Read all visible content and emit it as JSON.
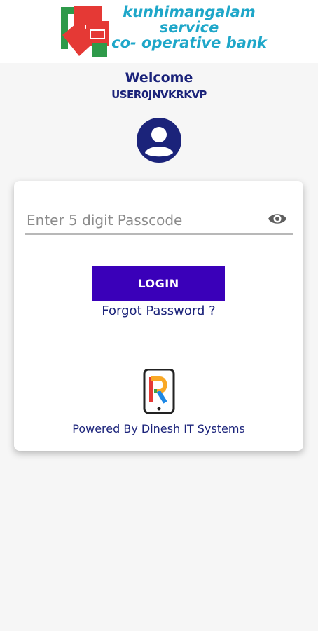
{
  "header": {
    "bank_name_line1": "kunhimangalam",
    "bank_name_line2": "service",
    "bank_name_line3": "co- operative bank",
    "logo_colors": {
      "red": "#e53935",
      "green": "#2e9a4a",
      "text": "#1fa7c9"
    }
  },
  "welcome": {
    "title": "Welcome",
    "user_code": "USER0JNVKRKVP",
    "avatar_icon": "user-avatar-icon"
  },
  "login_form": {
    "passcode_placeholder": "Enter 5 digit Passcode",
    "passcode_value": "",
    "visibility_icon": "eye-icon",
    "login_label": "LOGIN",
    "forgot_label": "Forgot Password ?"
  },
  "footer": {
    "powered_by": "Powered By Dinesh IT Systems",
    "vendor_logo_icon": "phone-r-logo-icon"
  },
  "colors": {
    "primary_button": "#3a00b9",
    "accent_text": "#1b237a",
    "background": "#f6f6f6"
  }
}
